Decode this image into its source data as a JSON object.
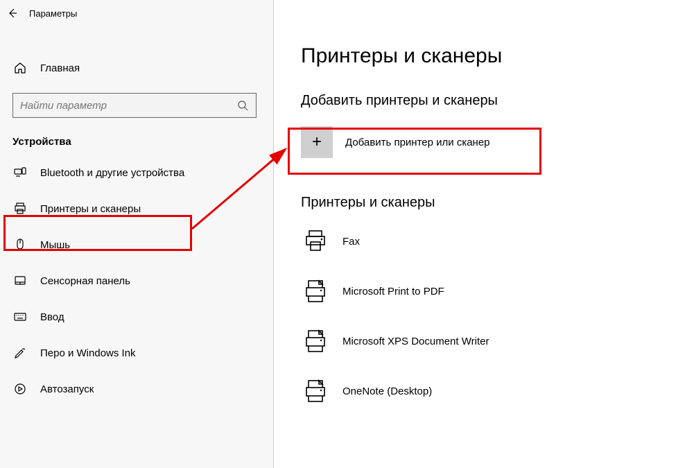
{
  "titlebar": {
    "title": "Параметры"
  },
  "home": {
    "label": "Главная"
  },
  "search": {
    "placeholder": "Найти параметр"
  },
  "section": {
    "heading": "Устройства"
  },
  "nav": {
    "items": [
      {
        "label": "Bluetooth и другие устройства"
      },
      {
        "label": "Принтеры и сканеры"
      },
      {
        "label": "Мышь"
      },
      {
        "label": "Сенсорная панель"
      },
      {
        "label": "Ввод"
      },
      {
        "label": "Перо и Windows Ink"
      },
      {
        "label": "Автозапуск"
      }
    ]
  },
  "page": {
    "title": "Принтеры и сканеры",
    "add_section": "Добавить принтеры и сканеры",
    "add_button": "Добавить принтер или сканер",
    "list_heading": "Принтеры и сканеры",
    "printers": [
      {
        "label": "Fax"
      },
      {
        "label": "Microsoft Print to PDF"
      },
      {
        "label": "Microsoft XPS Document Writer"
      },
      {
        "label": "OneNote (Desktop)"
      }
    ]
  }
}
